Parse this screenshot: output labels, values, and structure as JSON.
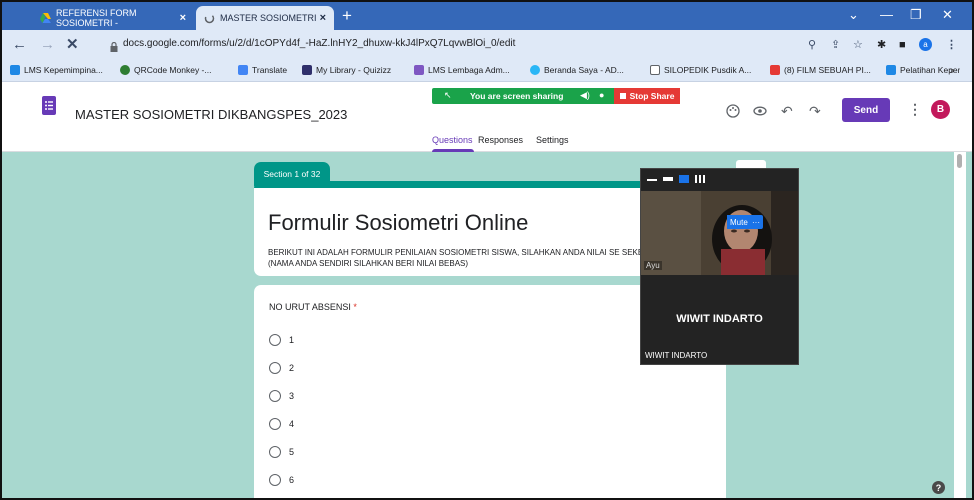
{
  "browser": {
    "tabs": [
      {
        "title": "REFERENSI FORM SOSIOMETRI -",
        "active": false
      },
      {
        "title": "MASTER SOSIOMETRI DIKBANGS",
        "active": true
      }
    ],
    "url": "docs.google.com/forms/u/2/d/1cOPYd4f_-HaZ.lnHY2_dhuxw-kkJ4lPxQ7LqvwBlOi_0/edit",
    "profile_letter": "a",
    "bookmarks": [
      "LMS Kepemimpina...",
      "QRCode Monkey -...",
      "Translate",
      "My Library - Quizizz",
      "LMS Lembaga Adm...",
      "Beranda Saya - AD...",
      "SILOPEDIK Pusdik A...",
      "(8) FILM SEBUAH PI...",
      "Pelatihan Kepemim..."
    ],
    "bookmarks_more": "»"
  },
  "screen_share": {
    "message": "You are screen sharing",
    "stop_label": "Stop Share"
  },
  "form_header": {
    "title": "MASTER SOSIOMETRI DIKBANGSPES_2023",
    "send_label": "Send",
    "avatar_letter": "B"
  },
  "form_tabs": [
    "Questions",
    "Responses",
    "Settings"
  ],
  "section_badge": "Section 1 of 32",
  "form_title": "Formulir Sosiometri Online",
  "form_description": "BERIKUT INI ADALAH FORMULIR PENILAIAN SOSIOMETRI SISWA, SILAHKAN ANDA NILAI SE SEKELAS ANDA (NAMA ANDA SENDIRI SILAHKAN BERI NILAI BEBAS)",
  "question": {
    "label": "NO URUT ABSENSI",
    "required_mark": "*",
    "options": [
      "1",
      "2",
      "3",
      "4",
      "5",
      "6"
    ]
  },
  "video_call": {
    "mute_label": "Mute",
    "more_label": "···",
    "camera_name": "Ayu",
    "big_name": "WIWIT INDARTO",
    "small_name": "WIWIT INDARTO"
  },
  "help_label": "?",
  "colors": {
    "tabbar": "#3568b8",
    "form_accent": "#673ab7",
    "section_accent": "#009688",
    "canvas_bg": "#a8d8cf",
    "share_green": "#1aa34a",
    "stop_red": "#e53935"
  }
}
